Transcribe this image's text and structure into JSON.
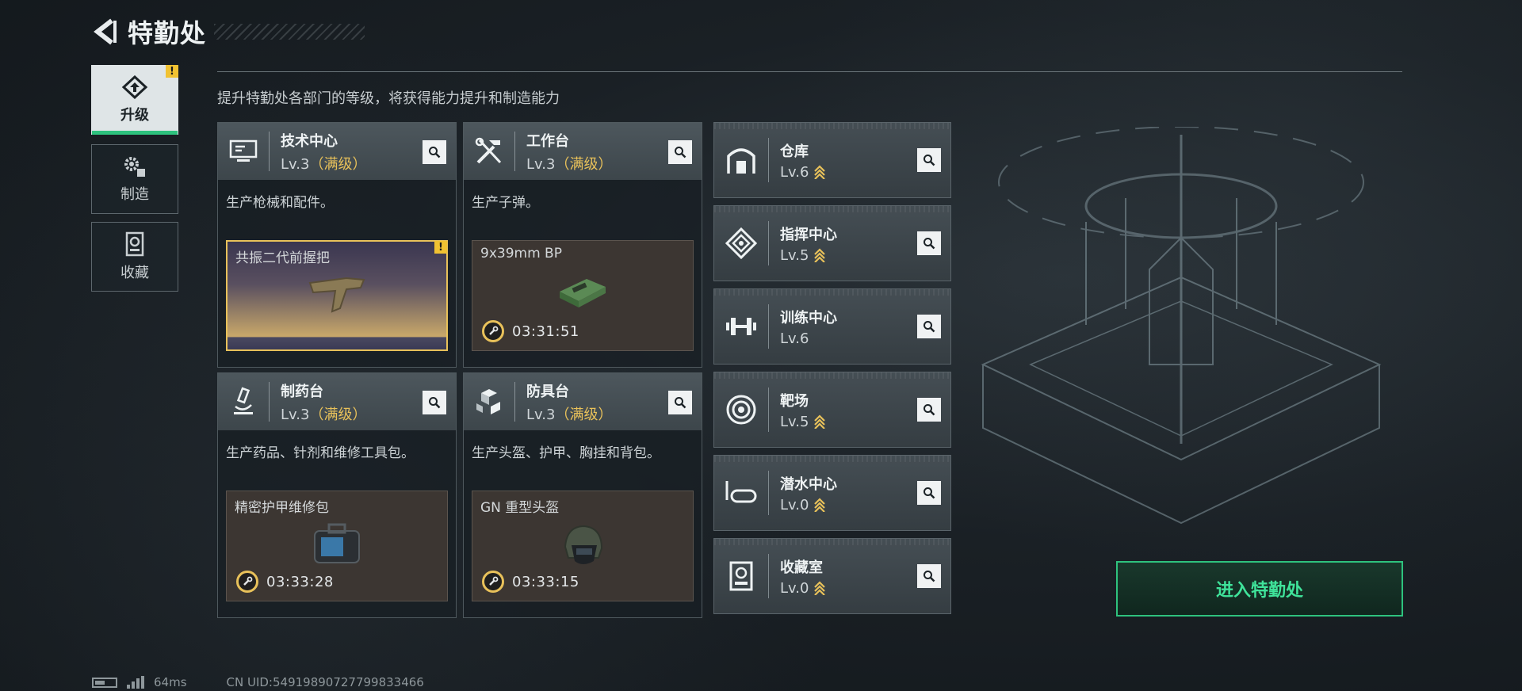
{
  "header": {
    "title": "特勤处"
  },
  "side_tabs": [
    {
      "label": "升级",
      "active": true,
      "warning": "!"
    },
    {
      "label": "制造",
      "active": false
    },
    {
      "label": "收藏",
      "active": false
    }
  ],
  "description": "提升特勤处各部门的等级，将获得能力提升和制造能力",
  "stations": [
    {
      "name": "技术中心",
      "level": "Lv.3",
      "max": "（满级）",
      "desc": "生产枪械和配件。",
      "craft": {
        "name": "共振二代前握把",
        "warning": "!"
      }
    },
    {
      "name": "工作台",
      "level": "Lv.3",
      "max": "（满级）",
      "desc": "生产子弹。",
      "craft": {
        "name": "9x39mm BP",
        "timer": "03:31:51"
      }
    },
    {
      "name": "制药台",
      "level": "Lv.3",
      "max": "（满级）",
      "desc": "生产药品、针剂和维修工具包。",
      "craft": {
        "name": "精密护甲维修包",
        "timer": "03:33:28"
      }
    },
    {
      "name": "防具台",
      "level": "Lv.3",
      "max": "（满级）",
      "desc": "生产头盔、护甲、胸挂和背包。",
      "craft": {
        "name": "GN 重型头盔",
        "timer": "03:33:15"
      }
    }
  ],
  "facilities": [
    {
      "name": "仓库",
      "level": "Lv.6",
      "upgradable": true,
      "icon": "warehouse-icon"
    },
    {
      "name": "指挥中心",
      "level": "Lv.5",
      "upgradable": true,
      "icon": "command-center-icon"
    },
    {
      "name": "训练中心",
      "level": "Lv.6",
      "upgradable": false,
      "icon": "dumbbell-icon"
    },
    {
      "name": "靶场",
      "level": "Lv.5",
      "upgradable": true,
      "icon": "target-icon"
    },
    {
      "name": "潜水中心",
      "level": "Lv.0",
      "upgradable": true,
      "icon": "diving-mask-icon"
    },
    {
      "name": "收藏室",
      "level": "Lv.0",
      "upgradable": true,
      "icon": "collection-room-icon"
    }
  ],
  "enter_button": "进入特勤处",
  "status": {
    "ping": "64ms",
    "uid": "CN UID:54919890727799833466"
  },
  "colors": {
    "accent_green": "#2ec27e",
    "gold": "#e8c15a"
  }
}
